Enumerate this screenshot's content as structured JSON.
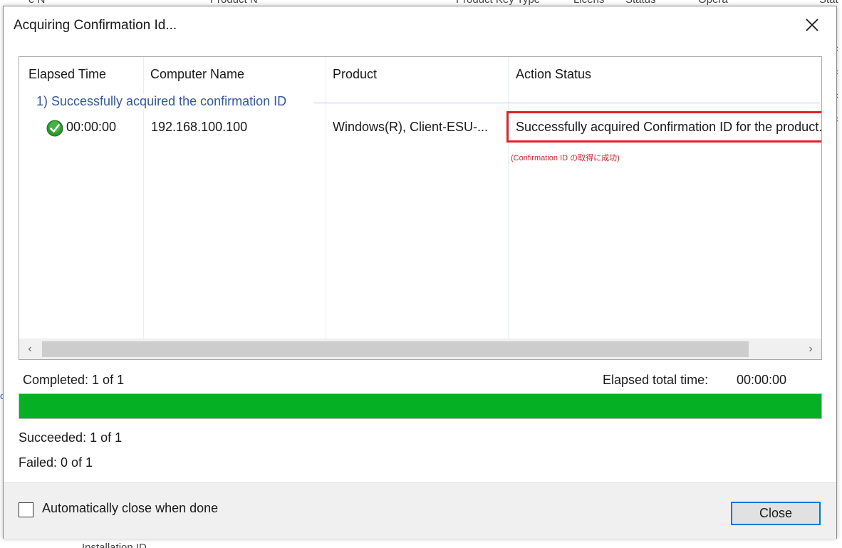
{
  "background": {
    "header_fragments": [
      "e N",
      "Product N",
      "Product Key Type",
      "Licens",
      "Status",
      "Opera",
      "Stat"
    ],
    "right_fragments": [
      "c",
      "c",
      "c",
      "c"
    ],
    "bottom_fragment": "Installation ID",
    "left_fragment": "o"
  },
  "dialog": {
    "title": "Acquiring Confirmation Id...",
    "columns": [
      "Elapsed Time",
      "Computer Name",
      "Product",
      "Action Status"
    ],
    "group_label": "1) Successfully acquired the confirmation ID",
    "row": {
      "elapsed": "00:00:00",
      "computer": "192.168.100.100",
      "product": "Windows(R), Client-ESU-...",
      "status": "Successfully acquired Confirmation ID for the product."
    },
    "annotation": "(Confirmation ID の取得に成功)",
    "scroll": {
      "left_arrow": "‹",
      "right_arrow": "›"
    },
    "completed": "Completed: 1 of 1",
    "elapsed_total_label": "Elapsed total time:",
    "elapsed_total_value": "00:00:00",
    "progress": 1.0,
    "succeeded": "Succeeded: 1 of 1",
    "failed": "Failed: 0 of 1",
    "auto_close_label": "Automatically close when done",
    "auto_close_checked": false,
    "close_button": "Close"
  },
  "colors": {
    "accent": "#0078d7",
    "progress": "#06b025",
    "highlight": "#e0212b",
    "group_text": "#3356a6"
  }
}
